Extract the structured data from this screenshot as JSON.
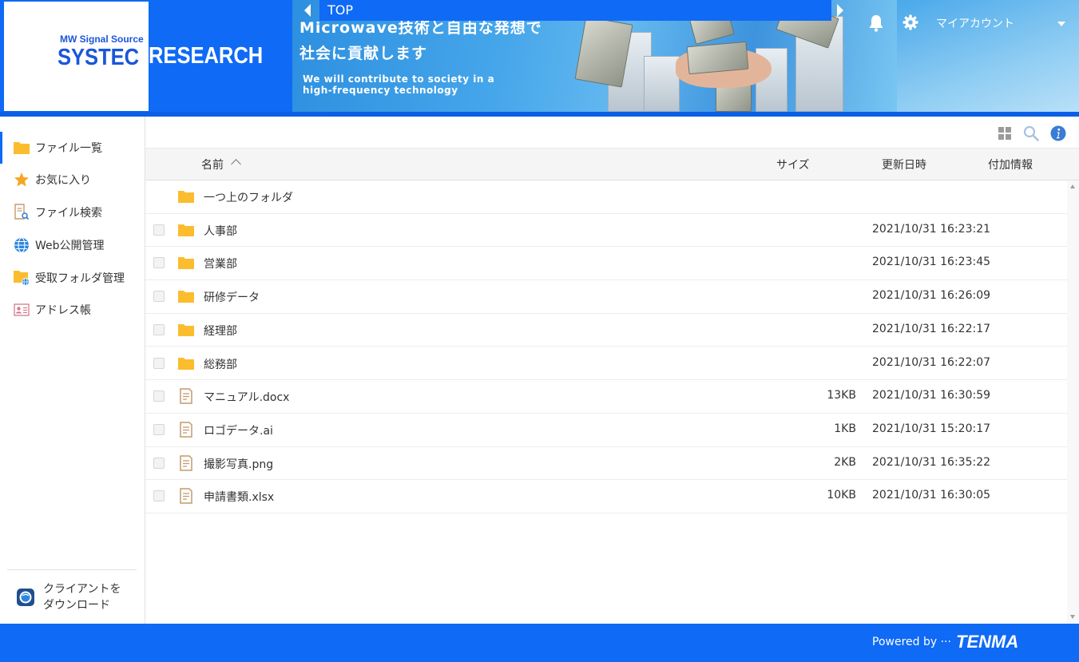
{
  "header": {
    "logo_small": "MW Signal Source",
    "logo_systec": "SYSTEC",
    "logo_research": "RESEARCH",
    "banner_jp_line1": "Microwave技術と自由な発想で",
    "banner_jp_line2": "社会に貢献します",
    "banner_en_line1": "We will contribute to society in a",
    "banner_en_line2": "high-frequency technology",
    "top_label": "TOP",
    "account_label": "マイアカウント"
  },
  "sidebar": {
    "items": [
      {
        "label": "ファイル一覧",
        "icon": "folder-icon"
      },
      {
        "label": "お気に入り",
        "icon": "star-icon"
      },
      {
        "label": "ファイル検索",
        "icon": "file-search-icon"
      },
      {
        "label": "Web公開管理",
        "icon": "globe-icon"
      },
      {
        "label": "受取フォルダ管理",
        "icon": "folder-globe-icon"
      },
      {
        "label": "アドレス帳",
        "icon": "address-card-icon"
      }
    ],
    "download_line1": "クライアントを",
    "download_line2": "ダウンロード"
  },
  "table": {
    "headers": {
      "name": "名前",
      "size": "サイズ",
      "updated": "更新日時",
      "extra": "付加情報"
    },
    "parent_folder": "一つ上のフォルダ",
    "rows": [
      {
        "type": "folder",
        "name": "人事部",
        "size": "",
        "date": "2021/10/31 16:23:21"
      },
      {
        "type": "folder",
        "name": "営業部",
        "size": "",
        "date": "2021/10/31 16:23:45"
      },
      {
        "type": "folder",
        "name": "研修データ",
        "size": "",
        "date": "2021/10/31 16:26:09"
      },
      {
        "type": "folder",
        "name": "経理部",
        "size": "",
        "date": "2021/10/31 16:22:17"
      },
      {
        "type": "folder",
        "name": "総務部",
        "size": "",
        "date": "2021/10/31 16:22:07"
      },
      {
        "type": "file",
        "name": "マニュアル.docx",
        "size": "13KB",
        "date": "2021/10/31 16:30:59"
      },
      {
        "type": "file",
        "name": "ロゴデータ.ai",
        "size": "1KB",
        "date": "2021/10/31 15:20:17"
      },
      {
        "type": "file",
        "name": "撮影写真.png",
        "size": "2KB",
        "date": "2021/10/31 16:35:22"
      },
      {
        "type": "file",
        "name": "申請書類.xlsx",
        "size": "10KB",
        "date": "2021/10/31 16:30:05"
      }
    ]
  },
  "footer": {
    "powered_by": "Powered by ···",
    "brand": "TENMA"
  },
  "colors": {
    "brand_blue": "#0f6af5",
    "folder_yellow": "#fbbd2d",
    "info_blue": "#3a7bd5"
  }
}
